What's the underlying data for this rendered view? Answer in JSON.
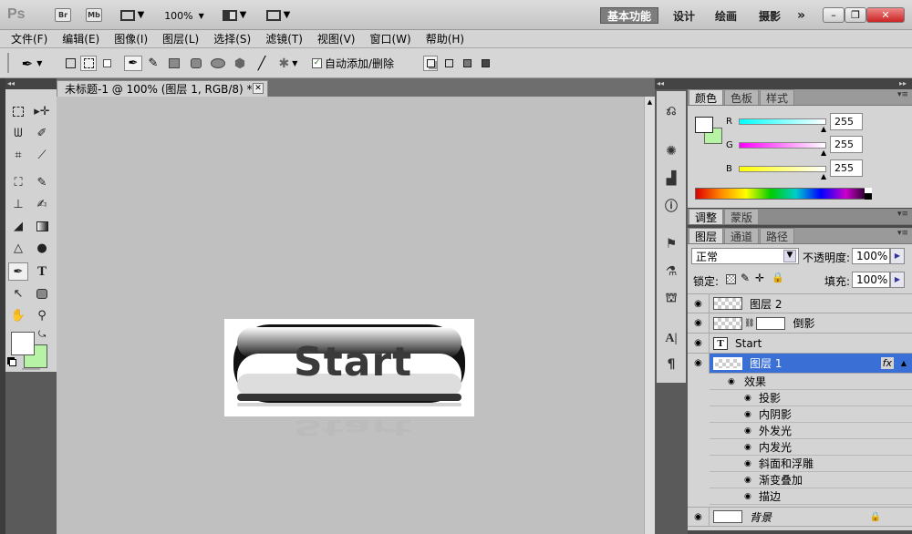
{
  "titlebar": {
    "app_logo": "Ps",
    "bridge": "Br",
    "minibridge": "Mb",
    "zoom": "100%",
    "workspaces": [
      "基本功能",
      "设计",
      "绘画",
      "摄影"
    ],
    "more": "»"
  },
  "menubar": {
    "items": [
      "文件(F)",
      "编辑(E)",
      "图像(I)",
      "图层(L)",
      "选择(S)",
      "滤镜(T)",
      "视图(V)",
      "窗口(W)",
      "帮助(H)"
    ]
  },
  "options": {
    "auto_add_delete": "自动添加/删除",
    "auto_add_checked": true
  },
  "document": {
    "tab_title": "未标题-1 @ 100% (图层 1, RGB/8) *",
    "image_text": "Start",
    "canvas_bg": "#c0c0c0"
  },
  "color_panel": {
    "tabs": [
      "颜色",
      "色板",
      "样式"
    ],
    "r_label": "R",
    "g_label": "G",
    "b_label": "B",
    "r": "255",
    "g": "255",
    "b": "255",
    "foreground": "#ffffff",
    "background": "#b6f3a4"
  },
  "adjust_panel": {
    "tabs": [
      "调整",
      "蒙版"
    ]
  },
  "layers_panel": {
    "tabs": [
      "图层",
      "通道",
      "路径"
    ],
    "blend_mode": "正常",
    "opacity_label": "不透明度:",
    "opacity": "100%",
    "lock_label": "锁定:",
    "fill_label": "填充:",
    "fill": "100%",
    "layers": [
      {
        "name": "图层 2",
        "type": "normal"
      },
      {
        "name": "倒影",
        "type": "mask"
      },
      {
        "name": "Start",
        "type": "text"
      },
      {
        "name": "图层 1",
        "type": "selected"
      }
    ],
    "effects_label": "效果",
    "effects": [
      "投影",
      "内阴影",
      "外发光",
      "内发光",
      "斜面和浮雕",
      "渐变叠加",
      "描边"
    ],
    "background_layer": "背景",
    "fx": "fx"
  },
  "colors": {
    "selected_layer": "#3a6fd6",
    "accent_green": "#b6f3a4"
  }
}
